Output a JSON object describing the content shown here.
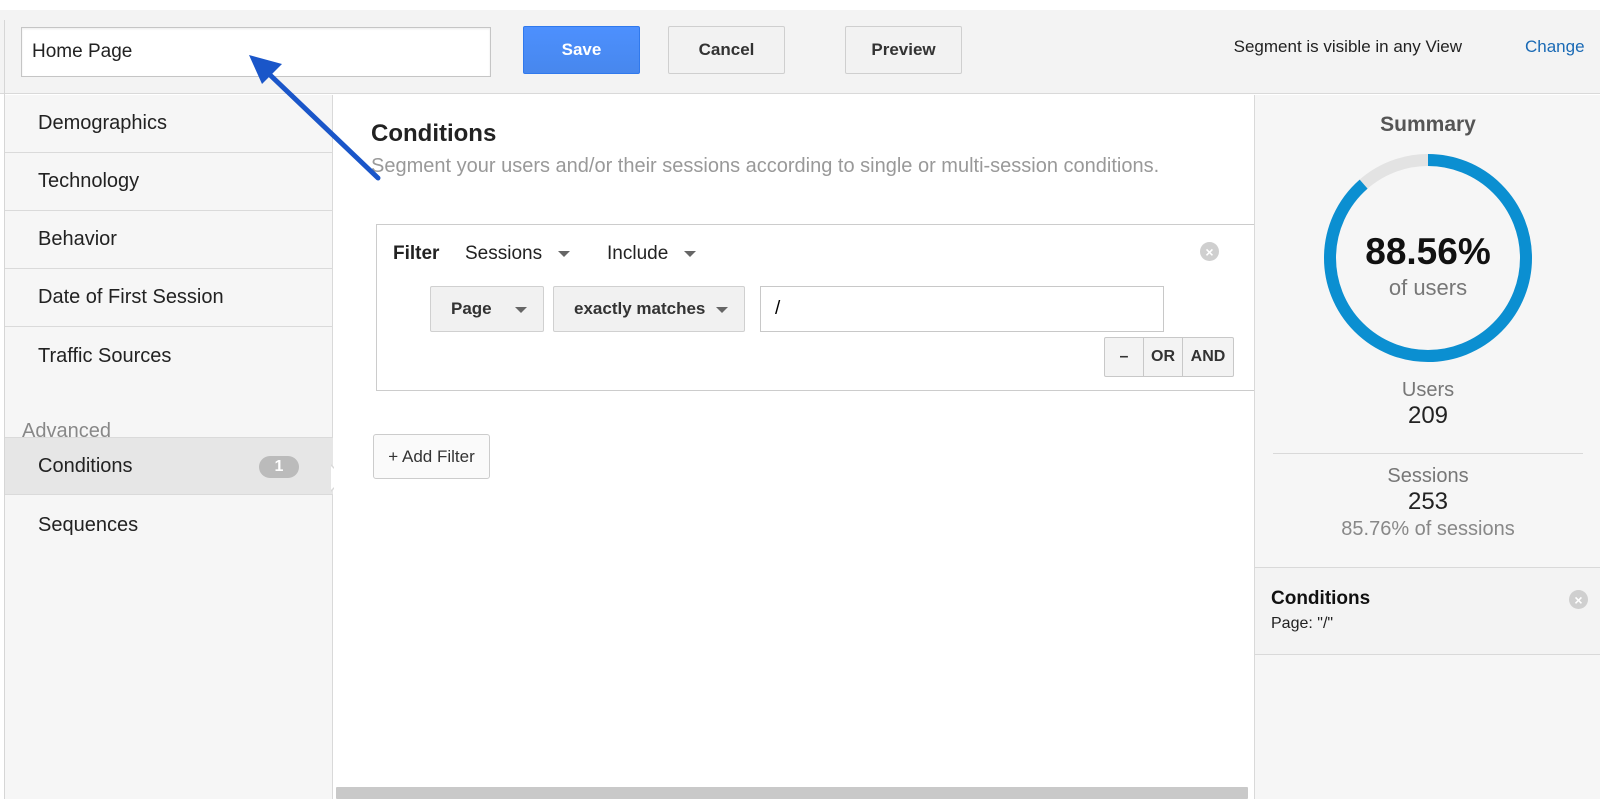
{
  "header": {
    "segment_name": "Home Page",
    "save_label": "Save",
    "cancel_label": "Cancel",
    "preview_label": "Preview",
    "visibility_text": "Segment is visible in any View",
    "change_label": "Change"
  },
  "sidebar": {
    "items": [
      {
        "label": "Demographics"
      },
      {
        "label": "Technology"
      },
      {
        "label": "Behavior"
      },
      {
        "label": "Date of First Session"
      },
      {
        "label": "Traffic Sources"
      }
    ],
    "advanced_label": "Advanced",
    "advanced_items": [
      {
        "label": "Conditions",
        "badge": "1",
        "active": true
      },
      {
        "label": "Sequences"
      }
    ]
  },
  "main": {
    "title": "Conditions",
    "subtitle": "Segment your users and/or their sessions according to single or multi-session conditions.",
    "filter": {
      "label": "Filter",
      "scope": "Sessions",
      "mode": "Include",
      "dimension": "Page",
      "operator": "exactly matches",
      "value": "/",
      "minus_label": "–",
      "or_label": "OR",
      "and_label": "AND"
    },
    "add_filter_label": "+ Add Filter"
  },
  "summary": {
    "title": "Summary",
    "percent": "88.56%",
    "percent_fraction": 0.8856,
    "percent_sub": "of users",
    "users_label": "Users",
    "users_value": "209",
    "sessions_label": "Sessions",
    "sessions_value": "253",
    "sessions_sub": "85.76% of sessions",
    "conditions_title": "Conditions",
    "conditions_desc": "Page: \"/\""
  },
  "colors": {
    "accent": "#4d90fe",
    "donut": "#0b8fd1",
    "donut_track": "#e3e3e3",
    "link": "#1a6ab5",
    "annotation_arrow": "#1a56c9"
  }
}
